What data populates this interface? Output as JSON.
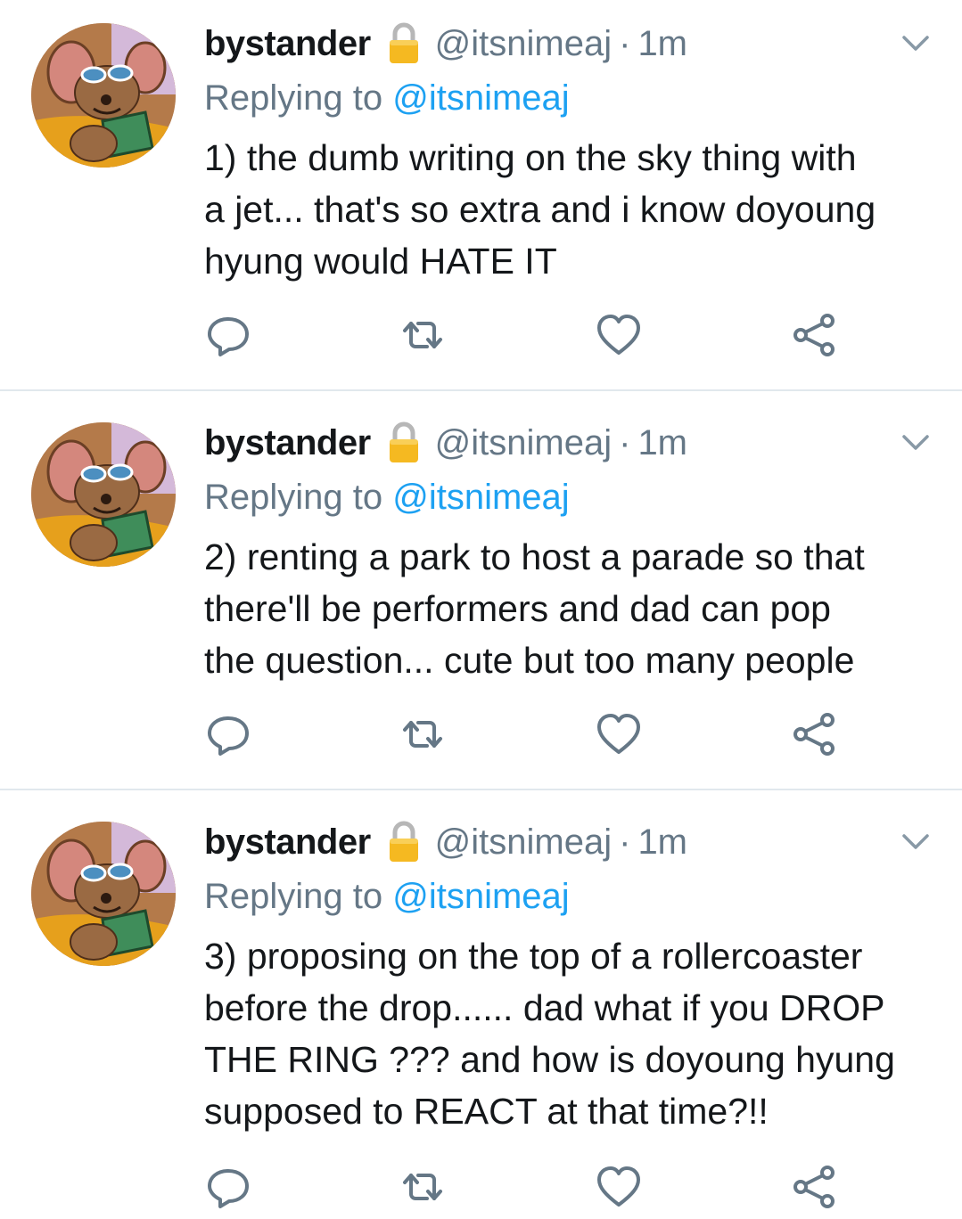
{
  "tweets": [
    {
      "display_name": "bystander",
      "handle": "@itsnimeaj",
      "separator": "·",
      "time": "1m",
      "replying_prefix": "Replying to ",
      "replying_handle": "@itsnimeaj",
      "text": "1) the dumb writing on the sky thing with\na jet... that's so extra and i know doyoung\nhyung would HATE IT"
    },
    {
      "display_name": "bystander",
      "handle": "@itsnimeaj",
      "separator": "·",
      "time": "1m",
      "replying_prefix": "Replying to ",
      "replying_handle": "@itsnimeaj",
      "text": "2) renting a park to host a parade so that\nthere'll be performers and dad can pop\nthe question... cute but too many people"
    },
    {
      "display_name": "bystander",
      "handle": "@itsnimeaj",
      "separator": "·",
      "time": "1m",
      "replying_prefix": "Replying to ",
      "replying_handle": "@itsnimeaj",
      "text": "3) proposing on the top of a rollercoaster\nbefore the drop...... dad what if you DROP\nTHE RING ??? and how is doyoung hyung\nsupposed to REACT at that time?!!"
    }
  ],
  "icons": {
    "lock": "lock-icon",
    "caret": "chevron-down-icon",
    "reply": "reply-icon",
    "retweet": "retweet-icon",
    "like": "heart-icon",
    "share": "share-icon",
    "avatar": "mouse-cartoon-avatar"
  },
  "colors": {
    "text_primary": "#14171a",
    "text_secondary": "#657786",
    "link": "#1da1f2",
    "divider": "#e1e8ed",
    "lock_body": "#f5b921"
  }
}
